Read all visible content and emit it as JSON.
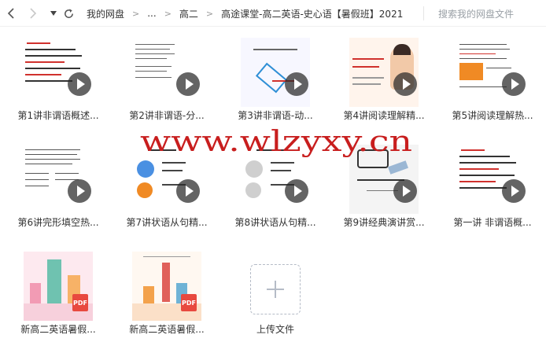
{
  "toolbar": {
    "back_icon": "chevron-left-icon",
    "forward_icon": "chevron-right-icon",
    "dropdown_icon": "caret-down-icon",
    "refresh_icon": "refresh-icon",
    "breadcrumbs": [
      "我的网盘",
      "...",
      "高二",
      "高途课堂-高二英语-史心语【暑假班】2021"
    ],
    "search_placeholder": "搜索我的网盘文件"
  },
  "files": [
    {
      "label": "第1讲非谓语概述...",
      "type": "video"
    },
    {
      "label": "第2讲非谓语-分...",
      "type": "video"
    },
    {
      "label": "第3讲非谓语-动...",
      "type": "video"
    },
    {
      "label": "第4讲阅读理解精...",
      "type": "video"
    },
    {
      "label": "第5讲阅读理解热...",
      "type": "video"
    },
    {
      "label": "第6讲完形填空热...",
      "type": "video"
    },
    {
      "label": "第7讲状语从句精...",
      "type": "video"
    },
    {
      "label": "第8讲状语从句精...",
      "type": "video"
    },
    {
      "label": "第9讲经典演讲赏...",
      "type": "video"
    },
    {
      "label": "第一讲 非谓语概...",
      "type": "video"
    },
    {
      "label": "新高二英语暑假...",
      "type": "pdf"
    },
    {
      "label": "新高二英语暑假...",
      "type": "pdf"
    },
    {
      "label": "上传文件",
      "type": "upload"
    }
  ],
  "watermark": "www.wlzyxy.cn",
  "colors": {
    "accent": "#d0312d",
    "watermark": "#c81e1e",
    "play_overlay": "#282828"
  }
}
